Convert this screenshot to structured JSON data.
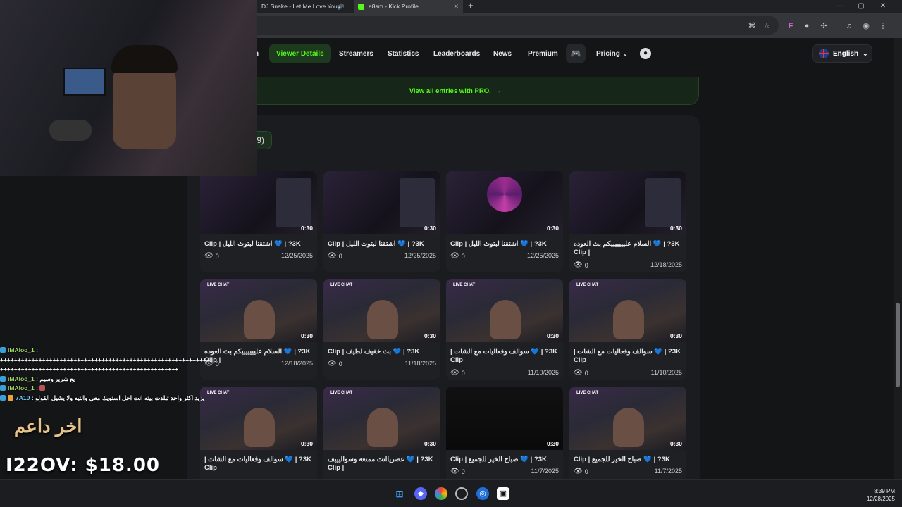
{
  "browser": {
    "tabs": [
      {
        "label": "DJ Snake - Let Me Love You",
        "active": false
      },
      {
        "label": "a8sm - Kick Profile",
        "active": true
      }
    ],
    "new_tab": "+",
    "controls": {
      "minimize": "—",
      "maximize": "▢",
      "close": "✕"
    }
  },
  "nav": {
    "partial": "n",
    "items": [
      "Viewer Details",
      "Streamers",
      "Statistics",
      "Leaderboards",
      "News",
      "Premium"
    ],
    "active": "Viewer Details",
    "pricing": "Pricing",
    "language": "English"
  },
  "view_all": "View all entries with PRO.",
  "count_partial": "9)",
  "clips": [
    {
      "title": "3K? | 💙 اشتقنا لبثوث الليل | Clip",
      "views": "0",
      "date": "12/25/2025",
      "duration": "0:30",
      "thumb": "game"
    },
    {
      "title": "3K? | 💙 اشتقنا لبثوث الليل | Clip",
      "views": "0",
      "date": "12/25/2025",
      "duration": "0:30",
      "thumb": "game"
    },
    {
      "title": "3K? | 💙 اشتقنا لبثوث الليل | Clip",
      "views": "0",
      "date": "12/25/2025",
      "duration": "0:30",
      "thumb": "wheel"
    },
    {
      "title": "3K? | 💙 السلام عليييييييكم بث العوده | Clip",
      "views": "0",
      "date": "12/18/2025",
      "duration": "0:30",
      "thumb": "game"
    },
    {
      "title": "3K? | 💙 السلام عليييييييكم بث العوده | Clip",
      "views": "0",
      "date": "12/18/2025",
      "duration": "0:30",
      "thumb": "live"
    },
    {
      "title": "3K? | 💙 بث خفيف لطيف | Clip",
      "views": "0",
      "date": "11/18/2025",
      "duration": "0:30",
      "thumb": "live"
    },
    {
      "title": "3K? | 💙 سوالف وفعاليات مع الشات | Clip",
      "views": "0",
      "date": "11/10/2025",
      "duration": "0:30",
      "thumb": "live"
    },
    {
      "title": "3K? | 💙 سوالف وفعاليات مع الشات | Clip",
      "views": "0",
      "date": "11/10/2025",
      "duration": "0:30",
      "thumb": "live"
    },
    {
      "title": "3K? | 💙 سوالف وفعاليات مع الشات | Clip",
      "views": "",
      "date": "",
      "duration": "0:30",
      "thumb": "live"
    },
    {
      "title": "3K? | 💙 عصريااتت ممتعة وسواليييف | Clip",
      "views": "",
      "date": "",
      "duration": "0:30",
      "thumb": "live"
    },
    {
      "title": "3K? | 💙 صباح الخير للجميع | Clip",
      "views": "0",
      "date": "11/7/2025",
      "duration": "0:30",
      "thumb": "dark"
    },
    {
      "title": "3K? | 💙 صباح الخير للجميع | Clip",
      "views": "0",
      "date": "11/7/2025",
      "duration": "0:30",
      "thumb": "live"
    }
  ],
  "overlay": {
    "chat": [
      {
        "user": "iMAloo_1",
        "msg": ":"
      },
      {
        "user": "",
        "msg": "++++++++++++++++++++++++++++++++++++++++++++++++++++++++++++"
      },
      {
        "user": "",
        "msg": "+++++++++++++++++++++++++++++++++++++++++++++++++++"
      },
      {
        "user": "iMAloo_1",
        "msg": ": يع شرير وسيم"
      },
      {
        "user": "iMAloo_1",
        "msg": ":"
      },
      {
        "user": "7A10",
        "msg": ": يزيد اكثر واحد تبلدت بيته انت احل استويك معي والتيه ولا يشيل القولو"
      }
    ],
    "sponsor": "اخر داعم",
    "amount": "I22OV: $18.00"
  },
  "taskbar": {
    "time": "8:39 PM",
    "date": "12/28/2025"
  }
}
